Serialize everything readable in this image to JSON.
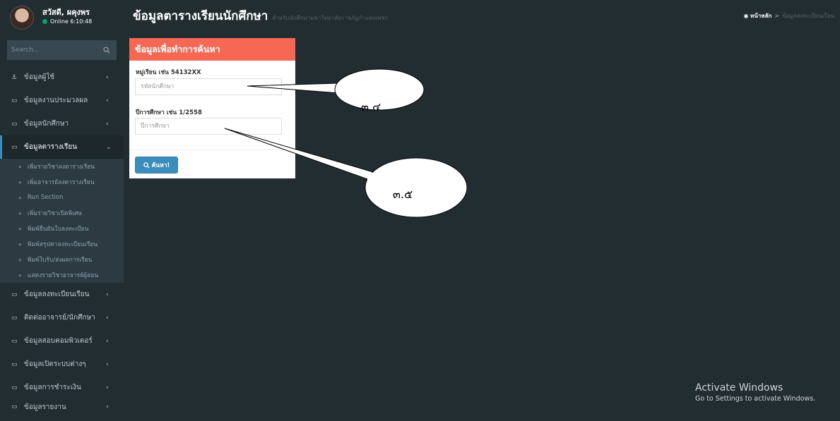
{
  "user": {
    "name": "สวัสดี, ผคุงพร",
    "status": "Online 6:10:48"
  },
  "search": {
    "placeholder": "Search..."
  },
  "sidebar": {
    "items": [
      {
        "label": "ข้อมูลผู้ใช้",
        "icon": "users-icon"
      },
      {
        "label": "ข้อมูลงานประมวลผล",
        "icon": "laptop-icon"
      },
      {
        "label": "ข้อมูลนักศึกษา",
        "icon": "laptop-icon"
      },
      {
        "label": "ข้อมูลตารางเรียน",
        "icon": "laptop-icon"
      }
    ],
    "submenu": [
      "เพิ่มรายวิชาลงตารางเรียน",
      "เพิ่มอาจารย์ลงตารางเรียน",
      "Run Section",
      "เพิ่มรายวิชาเปิดพิเศษ",
      "พิมพ์ยืนยันใบลงทะเบียน",
      "พิมพ์สรุปค่าลงทะเบียนเรียน",
      "พิมพ์ใบรับ/ส่งผลการเรียน",
      "แสดงรายวิชาอาจารย์ผู้สอน"
    ],
    "items_after": [
      "ข้อมูลลงทะเบียนเรียน",
      "ติดต่ออาจารย์/นักศึกษา",
      "ข้อมูลสอบคอมพิวเตอร์",
      "ข้อมูลเปิดระบบต่างๆ",
      "ข้อมูลการชำระเงิน",
      "ข้อมูลรายงาน"
    ]
  },
  "header": {
    "title": "ข้อมูลตารางเรียนนักศึกษา",
    "subtitle": "สำหรับนักศึกษามหาวิทยาลัยราชภัฏกำแพงเพชร",
    "breadcrumb": {
      "home": "หน้าหลัก",
      "separator": ">",
      "current": "ข้อมูลลงทะเบียนเรียน"
    }
  },
  "form": {
    "title": "ข้อมูลเพื่อทำการค้นหา",
    "field1_label": "หมู่เรียน เช่น 54132XX",
    "field1_placeholder": "รหัสนักศึกษา",
    "field2_label": "ปีการศึกษา เช่น 1/2558",
    "field2_placeholder": "ปีการศึกษา",
    "submit_label": "ค้นหา!"
  },
  "callouts": {
    "c1": "๓.๔",
    "c2": "๓.๕"
  },
  "watermark": {
    "line1": "Activate Windows",
    "line2": "Go to Settings to activate Windows."
  },
  "colors": {
    "sidebar_bg": "#222d32",
    "box_header": "#f56954",
    "button": "#3c8dbc",
    "online": "#00a65a"
  }
}
